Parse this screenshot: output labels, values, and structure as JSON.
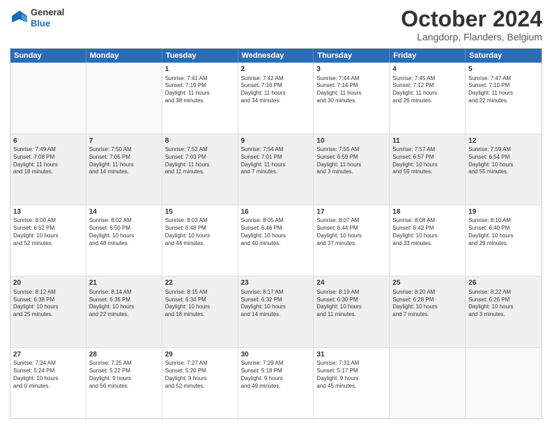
{
  "header": {
    "logo": {
      "general": "General",
      "blue": "Blue"
    },
    "title": "October 2024",
    "subtitle": "Langdorp, Flanders, Belgium"
  },
  "calendar": {
    "days": [
      "Sunday",
      "Monday",
      "Tuesday",
      "Wednesday",
      "Thursday",
      "Friday",
      "Saturday"
    ],
    "rows": [
      [
        {
          "day": "",
          "info": ""
        },
        {
          "day": "",
          "info": ""
        },
        {
          "day": "1",
          "info": "Sunrise: 7:41 AM\nSunset: 7:19 PM\nDaylight: 11 hours\nand 38 minutes."
        },
        {
          "day": "2",
          "info": "Sunrise: 7:42 AM\nSunset: 7:16 PM\nDaylight: 11 hours\nand 34 minutes."
        },
        {
          "day": "3",
          "info": "Sunrise: 7:44 AM\nSunset: 7:14 PM\nDaylight: 11 hours\nand 30 minutes."
        },
        {
          "day": "4",
          "info": "Sunrise: 7:45 AM\nSunset: 7:12 PM\nDaylight: 11 hours\nand 26 minutes."
        },
        {
          "day": "5",
          "info": "Sunrise: 7:47 AM\nSunset: 7:10 PM\nDaylight: 11 hours\nand 22 minutes."
        }
      ],
      [
        {
          "day": "6",
          "info": "Sunrise: 7:49 AM\nSunset: 7:08 PM\nDaylight: 11 hours\nand 18 minutes."
        },
        {
          "day": "7",
          "info": "Sunrise: 7:50 AM\nSunset: 7:05 PM\nDaylight: 11 hours\nand 14 minutes."
        },
        {
          "day": "8",
          "info": "Sunrise: 7:52 AM\nSunset: 7:03 PM\nDaylight: 11 hours\nand 11 minutes."
        },
        {
          "day": "9",
          "info": "Sunrise: 7:54 AM\nSunset: 7:01 PM\nDaylight: 11 hours\nand 7 minutes."
        },
        {
          "day": "10",
          "info": "Sunrise: 7:55 AM\nSunset: 6:59 PM\nDaylight: 11 hours\nand 3 minutes."
        },
        {
          "day": "11",
          "info": "Sunrise: 7:57 AM\nSunset: 6:57 PM\nDaylight: 10 hours\nand 59 minutes."
        },
        {
          "day": "12",
          "info": "Sunrise: 7:59 AM\nSunset: 6:54 PM\nDaylight: 10 hours\nand 55 minutes."
        }
      ],
      [
        {
          "day": "13",
          "info": "Sunrise: 8:00 AM\nSunset: 6:52 PM\nDaylight: 10 hours\nand 52 minutes."
        },
        {
          "day": "14",
          "info": "Sunrise: 8:02 AM\nSunset: 6:50 PM\nDaylight: 10 hours\nand 48 minutes."
        },
        {
          "day": "15",
          "info": "Sunrise: 8:03 AM\nSunset: 6:48 PM\nDaylight: 10 hours\nand 44 minutes."
        },
        {
          "day": "16",
          "info": "Sunrise: 8:05 AM\nSunset: 6:46 PM\nDaylight: 10 hours\nand 40 minutes."
        },
        {
          "day": "17",
          "info": "Sunrise: 8:07 AM\nSunset: 6:44 PM\nDaylight: 10 hours\nand 37 minutes."
        },
        {
          "day": "18",
          "info": "Sunrise: 8:08 AM\nSunset: 6:42 PM\nDaylight: 10 hours\nand 33 minutes."
        },
        {
          "day": "19",
          "info": "Sunrise: 8:10 AM\nSunset: 6:40 PM\nDaylight: 10 hours\nand 29 minutes."
        }
      ],
      [
        {
          "day": "20",
          "info": "Sunrise: 8:12 AM\nSunset: 6:38 PM\nDaylight: 10 hours\nand 25 minutes."
        },
        {
          "day": "21",
          "info": "Sunrise: 8:14 AM\nSunset: 6:36 PM\nDaylight: 10 hours\nand 22 minutes."
        },
        {
          "day": "22",
          "info": "Sunrise: 8:15 AM\nSunset: 6:34 PM\nDaylight: 10 hours\nand 18 minutes."
        },
        {
          "day": "23",
          "info": "Sunrise: 8:17 AM\nSunset: 6:32 PM\nDaylight: 10 hours\nand 14 minutes."
        },
        {
          "day": "24",
          "info": "Sunrise: 8:19 AM\nSunset: 6:30 PM\nDaylight: 10 hours\nand 11 minutes."
        },
        {
          "day": "25",
          "info": "Sunrise: 8:20 AM\nSunset: 6:28 PM\nDaylight: 10 hours\nand 7 minutes."
        },
        {
          "day": "26",
          "info": "Sunrise: 8:22 AM\nSunset: 6:26 PM\nDaylight: 10 hours\nand 3 minutes."
        }
      ],
      [
        {
          "day": "27",
          "info": "Sunrise: 7:24 AM\nSunset: 5:24 PM\nDaylight: 10 hours\nand 0 minutes."
        },
        {
          "day": "28",
          "info": "Sunrise: 7:25 AM\nSunset: 5:22 PM\nDaylight: 9 hours\nand 56 minutes."
        },
        {
          "day": "29",
          "info": "Sunrise: 7:27 AM\nSunset: 5:20 PM\nDaylight: 9 hours\nand 52 minutes."
        },
        {
          "day": "30",
          "info": "Sunrise: 7:29 AM\nSunset: 5:18 PM\nDaylight: 9 hours\nand 49 minutes."
        },
        {
          "day": "31",
          "info": "Sunrise: 7:31 AM\nSunset: 5:17 PM\nDaylight: 9 hours\nand 45 minutes."
        },
        {
          "day": "",
          "info": ""
        },
        {
          "day": "",
          "info": ""
        }
      ]
    ]
  }
}
